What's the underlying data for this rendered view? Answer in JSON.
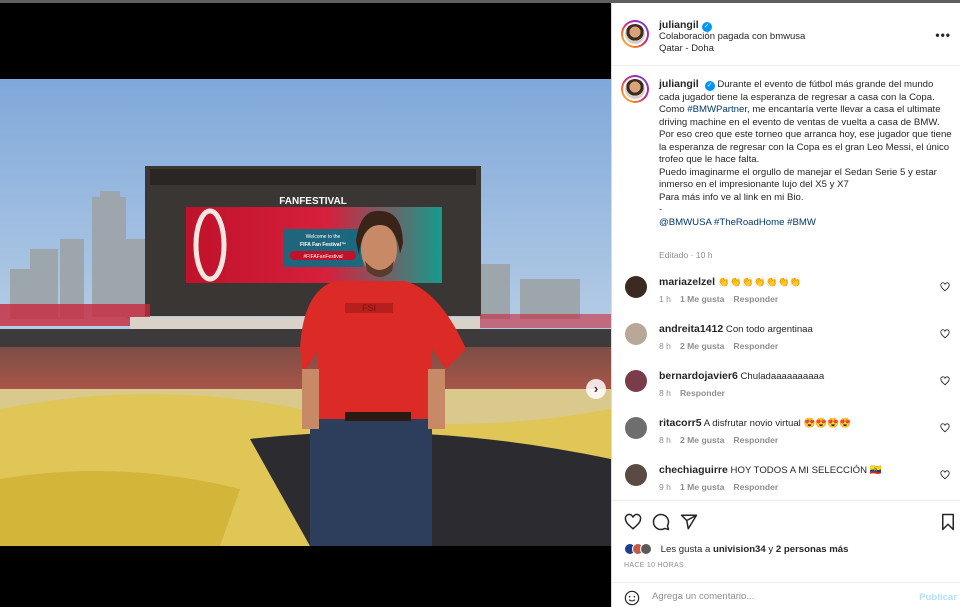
{
  "post": {
    "author": "juliangil",
    "collab_prefix": "Colaboración pagada con",
    "collab_partner": "bmwusa",
    "location": "Qatar - Doha",
    "more_icon": "more-horizontal-icon"
  },
  "photo": {
    "screen_brand": "FANFESTIVAL",
    "screen_welcome": "Welcome to the",
    "screen_title": "FIFA Fan Festival™",
    "screen_hashtag": "#FIFAFanFestival",
    "shirt_text": "FSI",
    "carousel": {
      "slides": 2,
      "active": 0
    }
  },
  "caption": {
    "username": "juliangil",
    "lines": [
      "Durante el evento de fútbol más grande del mundo cada jugador tiene la esperanza de regresar a casa con la Copa.",
      "Como #BMWPartner, me encantaría verte llevar a casa el ultimate driving machine en el evento de ventas de vuelta a casa de BMW.",
      "Por eso creo que este torneo que arranca hoy, ese jugador que tiene la esperanza de regresar con la Copa es el gran Leo Messi, el único trofeo que le hace falta.",
      "Puedo imaginarme el orgullo de manejar el Sedan Serie 5 y estar inmerso en el impresionante lujo del X5 y X7",
      "Para más info ve al link en mi Bio.",
      "-"
    ],
    "line2_prefix": "Como ",
    "line2_tag": "#BMWPartner",
    "line2_rest": ", me encantaría verte llevar a casa el ultimate driving machine en el evento de ventas de vuelta a casa de BMW.",
    "tags": "@BMWUSA #TheRoadHome #BMW",
    "edited": "Editado",
    "edited_time": "10 h"
  },
  "comments": [
    {
      "user": "mariazelzel",
      "text": "👏👏👏👏👏👏👏",
      "time": "1 h",
      "likes": "1 Me gusta",
      "reply": "Responder",
      "avatar_color": "#3a2a22"
    },
    {
      "user": "andreita1412",
      "text": "Con todo argentinaa",
      "time": "8 h",
      "likes": "2 Me gusta",
      "reply": "Responder",
      "avatar_color": "#b9a79a"
    },
    {
      "user": "bernardojavier6",
      "text": "Chuladaaaaaaaaaa",
      "time": "8 h",
      "likes": "",
      "reply": "Responder",
      "avatar_color": "#7a3b4a"
    },
    {
      "user": "ritacorr5",
      "text": "A disfrutar novio virtual 😍😍😍😍",
      "time": "8 h",
      "likes": "2 Me gusta",
      "reply": "Responder",
      "avatar_color": "#6e6e6e"
    },
    {
      "user": "chechiaguirre",
      "text": "HOY TODOS A MI SELECCIÓN 🇪🇨",
      "time": "9 h",
      "likes": "1 Me gusta",
      "reply": "Responder",
      "avatar_color": "#5a4a44"
    }
  ],
  "actions": {
    "like_icon": "heart-icon",
    "comment_icon": "comment-icon",
    "share_icon": "share-icon",
    "save_icon": "bookmark-icon",
    "likes_prefix": "Les gusta a",
    "likes_user": "univision34",
    "likes_mid": "y",
    "likes_others": "2 personas más",
    "posted_ago": "HACE 10 HORAS"
  },
  "comment_input": {
    "placeholder": "Agrega un comentario...",
    "value": "",
    "publish_label": "Publicar"
  }
}
